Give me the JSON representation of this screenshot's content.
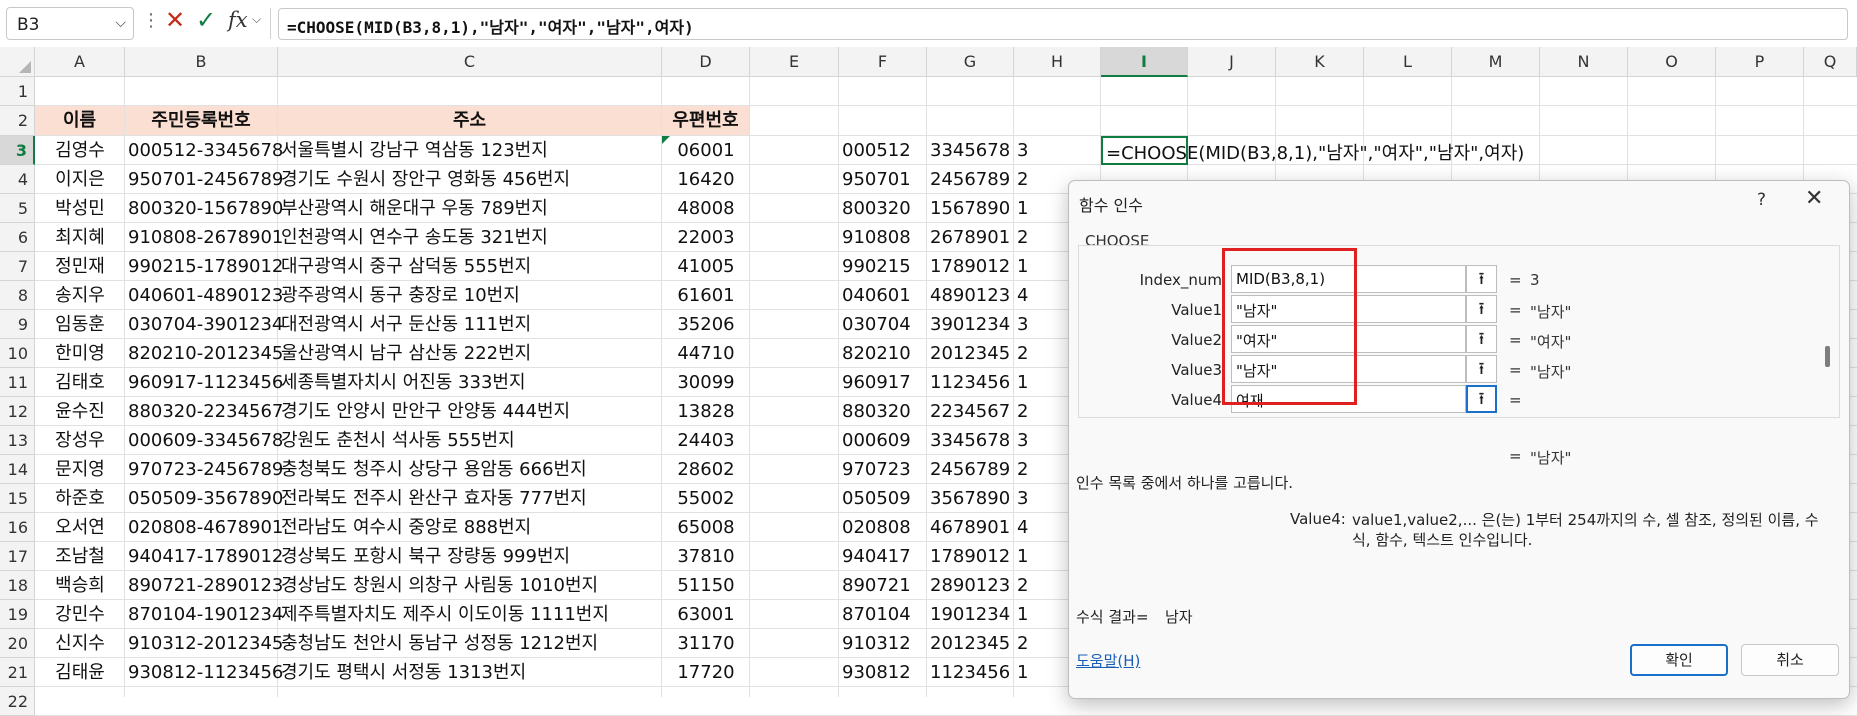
{
  "formula_bar": {
    "name_box": "B3",
    "formula": "=CHOOSE(MID(B3,8,1),\"남자\",\"여자\",\"남자\",여자)",
    "fx_label": "fx",
    "dots": "⋮",
    "cancel_icon": "✕",
    "enter_icon": "✓"
  },
  "columns": [
    "A",
    "B",
    "C",
    "D",
    "E",
    "F",
    "G",
    "H",
    "I",
    "J",
    "K",
    "L",
    "M",
    "N",
    "O",
    "P",
    "Q"
  ],
  "row_numbers": [
    "1",
    "2",
    "3",
    "4",
    "5",
    "6",
    "7",
    "8",
    "9",
    "10",
    "11",
    "12",
    "13",
    "14",
    "15",
    "16",
    "17",
    "18",
    "19",
    "20",
    "21",
    "22"
  ],
  "table_headers": {
    "name": "이름",
    "rrn": "주민등록번호",
    "address": "주소",
    "zip": "우편번호"
  },
  "rows": [
    {
      "name": "김영수",
      "rrn": "000512-3345678",
      "address": "서울특별시 강남구 역삼동 123번지",
      "zip": "06001",
      "f": "000512",
      "g": "3345678",
      "h": "3"
    },
    {
      "name": "이지은",
      "rrn": "950701-2456789",
      "address": "경기도 수원시 장안구 영화동 456번지",
      "zip": "16420",
      "f": "950701",
      "g": "2456789",
      "h": "2"
    },
    {
      "name": "박성민",
      "rrn": "800320-1567890",
      "address": "부산광역시 해운대구 우동 789번지",
      "zip": "48008",
      "f": "800320",
      "g": "1567890",
      "h": "1"
    },
    {
      "name": "최지혜",
      "rrn": "910808-2678901",
      "address": "인천광역시 연수구 송도동 321번지",
      "zip": "22003",
      "f": "910808",
      "g": "2678901",
      "h": "2"
    },
    {
      "name": "정민재",
      "rrn": "990215-1789012",
      "address": "대구광역시 중구 삼덕동 555번지",
      "zip": "41005",
      "f": "990215",
      "g": "1789012",
      "h": "1"
    },
    {
      "name": "송지우",
      "rrn": "040601-4890123",
      "address": "광주광역시 동구 충장로 10번지",
      "zip": "61601",
      "f": "040601",
      "g": "4890123",
      "h": "4"
    },
    {
      "name": "임동훈",
      "rrn": "030704-3901234",
      "address": "대전광역시 서구 둔산동 111번지",
      "zip": "35206",
      "f": "030704",
      "g": "3901234",
      "h": "3"
    },
    {
      "name": "한미영",
      "rrn": "820210-2012345",
      "address": "울산광역시 남구 삼산동 222번지",
      "zip": "44710",
      "f": "820210",
      "g": "2012345",
      "h": "2"
    },
    {
      "name": "김태호",
      "rrn": "960917-1123456",
      "address": "세종특별자치시 어진동 333번지",
      "zip": "30099",
      "f": "960917",
      "g": "1123456",
      "h": "1"
    },
    {
      "name": "윤수진",
      "rrn": "880320-2234567",
      "address": "경기도 안양시 만안구 안양동 444번지",
      "zip": "13828",
      "f": "880320",
      "g": "2234567",
      "h": "2"
    },
    {
      "name": "장성우",
      "rrn": "000609-3345678",
      "address": "강원도 춘천시 석사동 555번지",
      "zip": "24403",
      "f": "000609",
      "g": "3345678",
      "h": "3"
    },
    {
      "name": "문지영",
      "rrn": "970723-2456789",
      "address": "충청북도 청주시 상당구 용암동 666번지",
      "zip": "28602",
      "f": "970723",
      "g": "2456789",
      "h": "2"
    },
    {
      "name": "하준호",
      "rrn": "050509-3567890",
      "address": "전라북도 전주시 완산구 효자동 777번지",
      "zip": "55002",
      "f": "050509",
      "g": "3567890",
      "h": "3"
    },
    {
      "name": "오서연",
      "rrn": "020808-4678901",
      "address": "전라남도 여수시 중앙로 888번지",
      "zip": "65008",
      "f": "020808",
      "g": "4678901",
      "h": "4"
    },
    {
      "name": "조남철",
      "rrn": "940417-1789012",
      "address": "경상북도 포항시 북구 장량동 999번지",
      "zip": "37810",
      "f": "940417",
      "g": "1789012",
      "h": "1"
    },
    {
      "name": "백승희",
      "rrn": "890721-2890123",
      "address": "경상남도 창원시 의창구 사림동 1010번지",
      "zip": "51150",
      "f": "890721",
      "g": "2890123",
      "h": "2"
    },
    {
      "name": "강민수",
      "rrn": "870104-1901234",
      "address": "제주특별자치도 제주시 이도이동 1111번지",
      "zip": "63001",
      "f": "870104",
      "g": "1901234",
      "h": "1"
    },
    {
      "name": "신지수",
      "rrn": "910312-2012345",
      "address": "충청남도 천안시 동남구 성정동 1212번지",
      "zip": "31170",
      "f": "910312",
      "g": "2012345",
      "h": "2"
    },
    {
      "name": "김태윤",
      "rrn": "930812-1123456",
      "address": "경기도 평택시 서정동 1313번지",
      "zip": "17720",
      "f": "930812",
      "g": "1123456",
      "h": "1"
    }
  ],
  "active_cell_text": "=CHOOSE(MID(B3,8,1),\"남자\",\"여자\",\"남자\",여자)",
  "dialog": {
    "title": "함수 인수",
    "help_glyph": "?",
    "close_glyph": "✕",
    "function_name": "CHOOSE",
    "args": [
      {
        "label": "Index_num",
        "value": "MID(B3,8,1)",
        "eq": "=",
        "result": "3"
      },
      {
        "label": "Value1",
        "value": "\"남자\"",
        "eq": "=",
        "result": "\"남자\""
      },
      {
        "label": "Value2",
        "value": "\"여자\"",
        "eq": "=",
        "result": "\"여자\""
      },
      {
        "label": "Value3",
        "value": "\"남자\"",
        "eq": "=",
        "result": "\"남자\""
      },
      {
        "label": "Value4",
        "value": "여재",
        "eq": "=",
        "result": ""
      }
    ],
    "ref_glyph": "⭱",
    "overall_eq": "=",
    "overall_result": "\"남자\"",
    "function_description": "인수 목록 중에서 하나를 고릅니다.",
    "arg_desc_name": "Value4:",
    "arg_desc_text": "value1,value2,... 은(는) 1부터 254까지의 수, 셀 참조, 정의된 이름, 수식, 함수, 텍스트 인수입니다.",
    "formula_result_label": "수식 결과=",
    "formula_result_value": "남자",
    "help_link": "도움말(H)",
    "ok": "확인",
    "cancel": "취소"
  },
  "colors": {
    "header_fill": "#fcdfd3",
    "accent_green": "#107c41",
    "highlight_red": "#e02020",
    "focus_blue": "#1a6fc9"
  }
}
